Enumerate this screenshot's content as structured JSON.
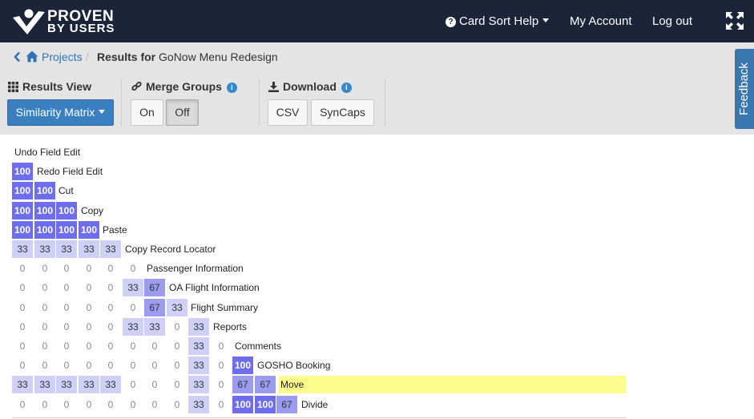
{
  "header": {
    "logo_line1": "PROVEN",
    "logo_line2": "BY USERS",
    "help_label": "Card Sort Help",
    "account_label": "My Account",
    "logout_label": "Log out",
    "fullscreen_icon": "expand-icon"
  },
  "breadcrumb": {
    "projects_label": "Projects",
    "separator": "/",
    "current_prefix": "Results for",
    "current_name": "GoNow Menu Redesign"
  },
  "toolbar": {
    "results_view_label": "Results View",
    "results_view_value": "Similarity Matrix",
    "merge_groups_label": "Merge Groups",
    "merge_on": "On",
    "merge_off": "Off",
    "merge_selected": "Off",
    "download_label": "Download",
    "download_csv": "CSV",
    "download_syncaps": "SynCaps"
  },
  "feedback_label": "Feedback",
  "matrix": {
    "rows": [
      {
        "label": "Undo Field Edit",
        "values": []
      },
      {
        "label": "Redo Field Edit",
        "values": [
          100
        ]
      },
      {
        "label": "Cut",
        "values": [
          100,
          100
        ]
      },
      {
        "label": "Copy",
        "values": [
          100,
          100,
          100
        ]
      },
      {
        "label": "Paste",
        "values": [
          100,
          100,
          100,
          100
        ]
      },
      {
        "label": "Copy Record Locator",
        "values": [
          33,
          33,
          33,
          33,
          33
        ]
      },
      {
        "label": "Passenger Information",
        "values": [
          0,
          0,
          0,
          0,
          0,
          0
        ]
      },
      {
        "label": "OA Flight Information",
        "values": [
          0,
          0,
          0,
          0,
          0,
          33,
          67
        ]
      },
      {
        "label": "Flight Summary",
        "values": [
          0,
          0,
          0,
          0,
          0,
          0,
          67,
          33
        ]
      },
      {
        "label": "Reports",
        "values": [
          0,
          0,
          0,
          0,
          0,
          33,
          33,
          0,
          33
        ]
      },
      {
        "label": "Comments",
        "values": [
          0,
          0,
          0,
          0,
          0,
          0,
          0,
          0,
          33,
          0
        ]
      },
      {
        "label": "GOSHO Booking",
        "values": [
          0,
          0,
          0,
          0,
          0,
          0,
          0,
          0,
          33,
          0,
          100
        ]
      },
      {
        "label": "Move",
        "values": [
          33,
          33,
          33,
          33,
          33,
          0,
          0,
          0,
          33,
          0,
          67,
          67
        ],
        "highlight": true
      },
      {
        "label": "Divide",
        "values": [
          0,
          0,
          0,
          0,
          0,
          0,
          0,
          0,
          33,
          0,
          100,
          100,
          67
        ]
      }
    ],
    "colors": {
      "v33": "#cfcff7",
      "v67": "#9b9bf0",
      "v100": "#6d6ded",
      "highlight": "#fdfd8e"
    }
  }
}
